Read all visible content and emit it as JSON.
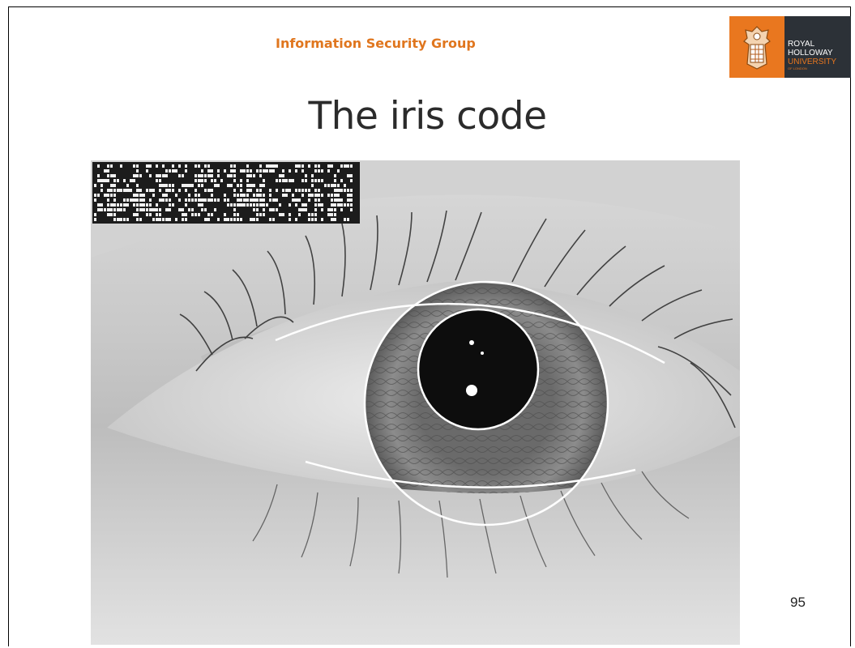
{
  "header": {
    "group_name": "Information Security Group",
    "logo": {
      "line1": "ROYAL",
      "line2": "HOLLOWAY",
      "line3": "UNIVERSITY",
      "line4": "OF LONDON",
      "brand_orange": "#e9771f",
      "brand_dark": "#2c3137"
    }
  },
  "slide": {
    "title": "The iris code",
    "page_number": "95"
  },
  "image": {
    "subject": "eye-photo",
    "overlay": "iris-code-barcode"
  }
}
